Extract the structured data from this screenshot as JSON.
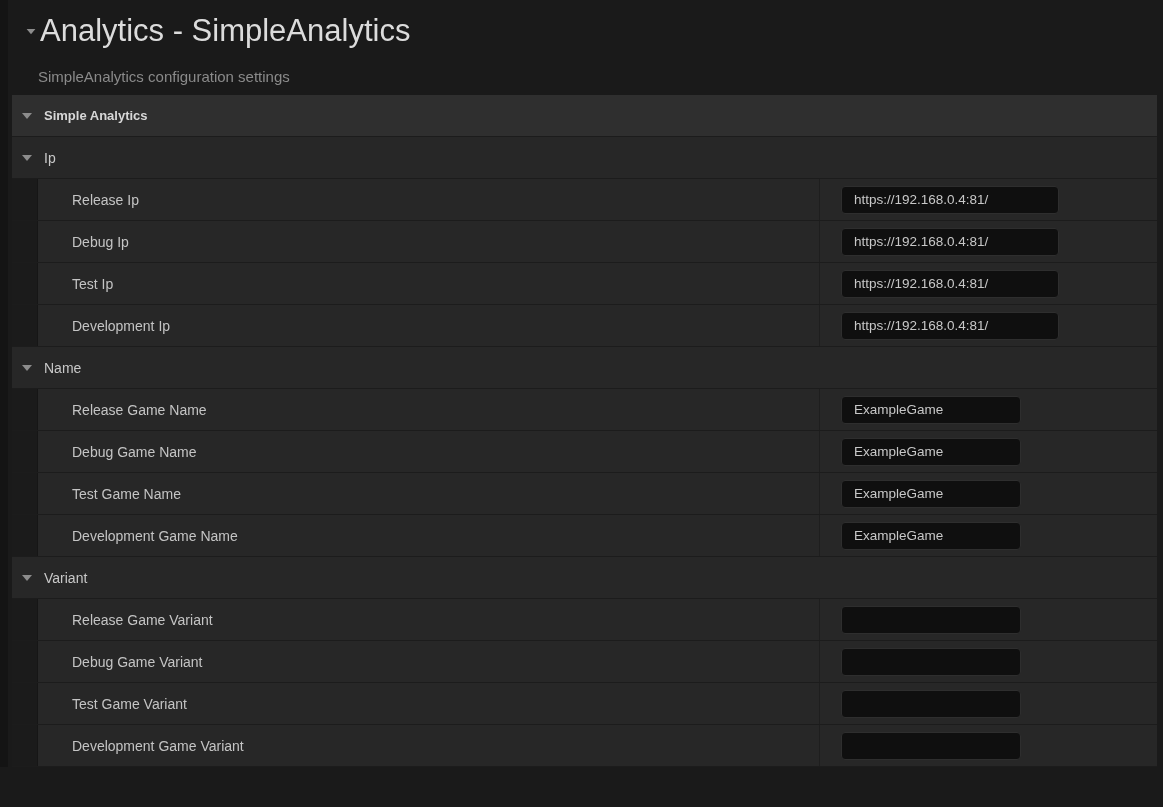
{
  "header": {
    "title": "Analytics - SimpleAnalytics",
    "expanded": true,
    "description": "SimpleAnalytics configuration settings"
  },
  "category": {
    "label": "Simple Analytics",
    "expanded": true,
    "groups": [
      {
        "label": "Ip",
        "expanded": true,
        "properties": [
          {
            "label": "Release Ip",
            "value": "https://192.168.0.4:81/"
          },
          {
            "label": "Debug Ip",
            "value": "https://192.168.0.4:81/"
          },
          {
            "label": "Test Ip",
            "value": "https://192.168.0.4:81/"
          },
          {
            "label": "Development Ip",
            "value": "https://192.168.0.4:81/"
          }
        ]
      },
      {
        "label": "Name",
        "expanded": true,
        "properties": [
          {
            "label": "Release Game Name",
            "value": "ExampleGame"
          },
          {
            "label": "Debug Game Name",
            "value": "ExampleGame"
          },
          {
            "label": "Test Game Name",
            "value": "ExampleGame"
          },
          {
            "label": "Development Game Name",
            "value": "ExampleGame"
          }
        ]
      },
      {
        "label": "Variant",
        "expanded": true,
        "properties": [
          {
            "label": "Release Game Variant"
          },
          {
            "label": "Debug Game Variant"
          },
          {
            "label": "Test Game Variant"
          },
          {
            "label": "Development Game Variant"
          }
        ]
      }
    ]
  }
}
